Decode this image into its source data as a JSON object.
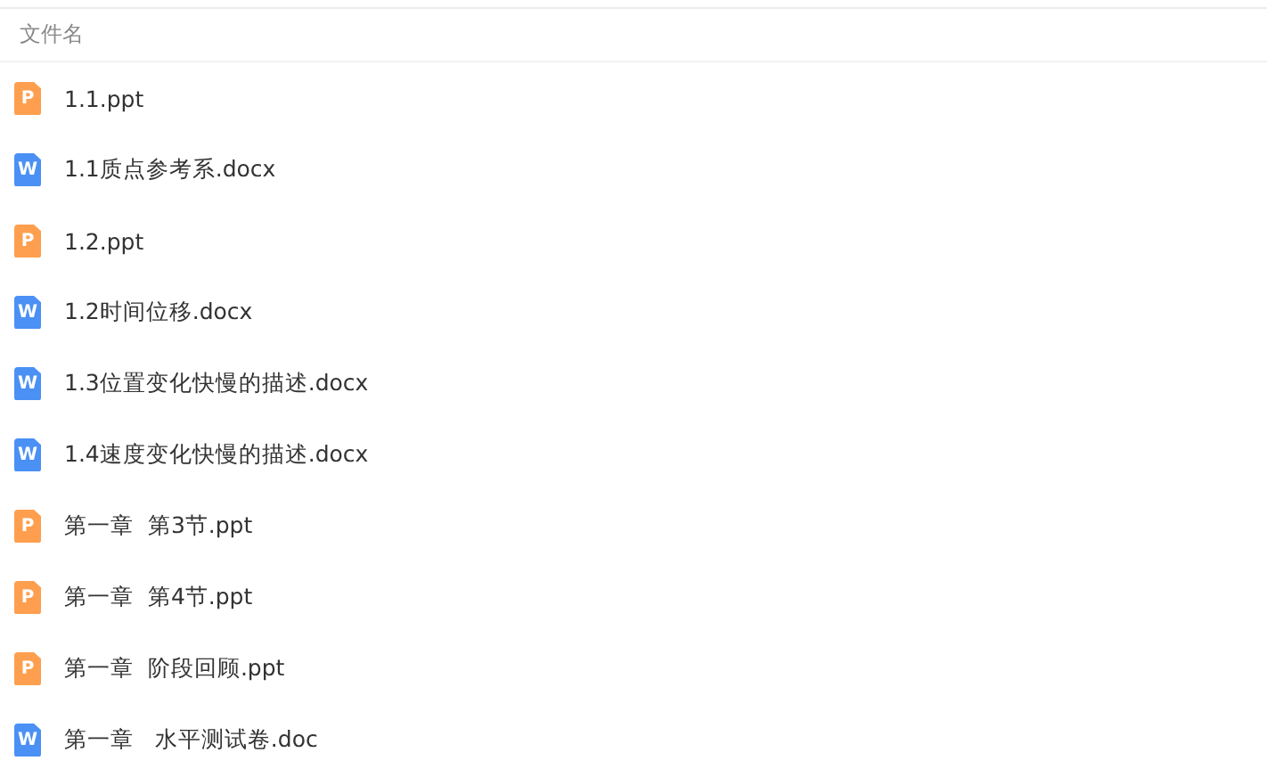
{
  "header": {
    "label": "文件名"
  },
  "files": [
    {
      "name": "1.1.ppt",
      "kind": "ppt",
      "icon_letter": "P"
    },
    {
      "name": "1.1质点参考系.docx",
      "kind": "doc",
      "icon_letter": "W"
    },
    {
      "name": "1.2.ppt",
      "kind": "ppt",
      "icon_letter": "P"
    },
    {
      "name": "1.2时间位移.docx",
      "kind": "doc",
      "icon_letter": "W"
    },
    {
      "name": "1.3位置变化快慢的描述.docx",
      "kind": "doc",
      "icon_letter": "W"
    },
    {
      "name": "1.4速度变化快慢的描述.docx",
      "kind": "doc",
      "icon_letter": "W"
    },
    {
      "name": "第一章  第3节.ppt",
      "kind": "ppt",
      "icon_letter": "P"
    },
    {
      "name": "第一章  第4节.ppt",
      "kind": "ppt",
      "icon_letter": "P"
    },
    {
      "name": "第一章  阶段回顾.ppt",
      "kind": "ppt",
      "icon_letter": "P"
    },
    {
      "name": "第一章   水平测试卷.doc",
      "kind": "doc",
      "icon_letter": "W"
    }
  ]
}
